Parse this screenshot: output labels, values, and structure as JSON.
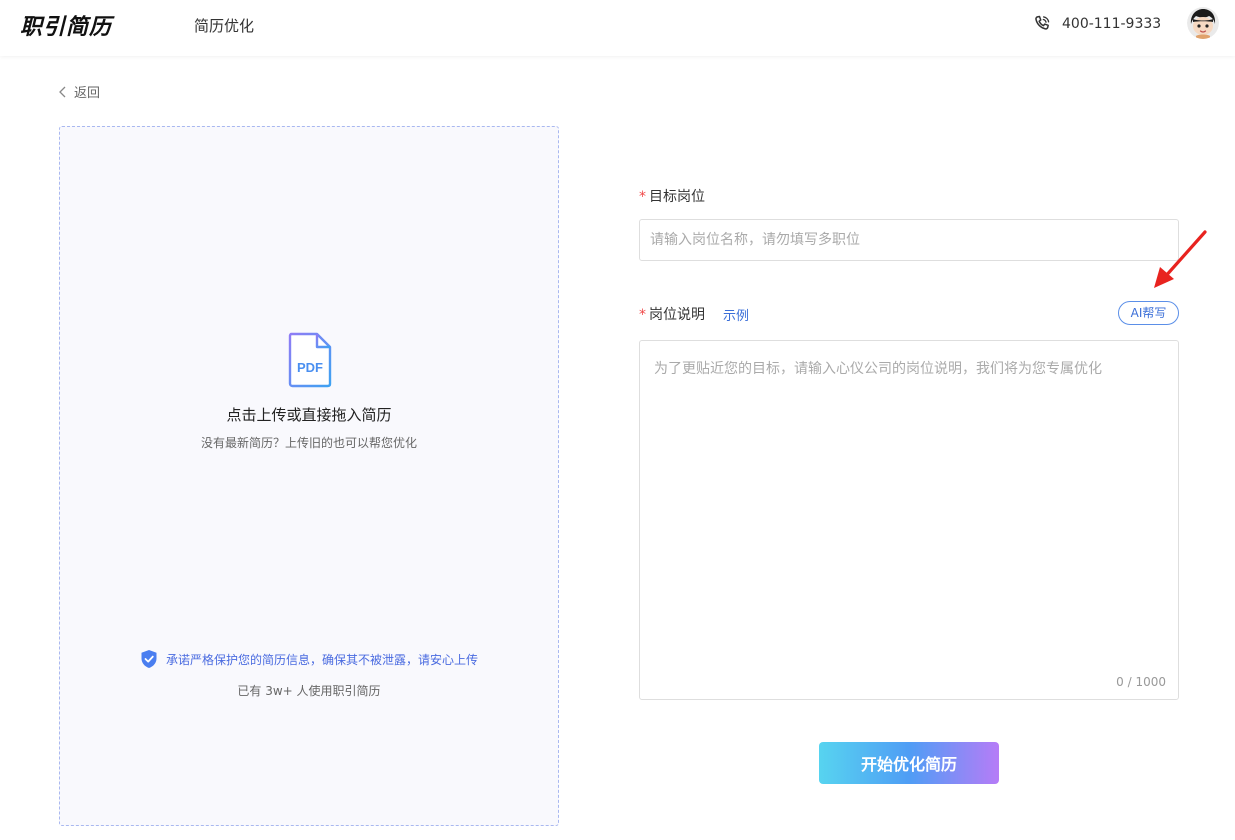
{
  "header": {
    "logo": "职引简历",
    "nav_item": "简历优化",
    "phone": "400-111-9333"
  },
  "back_label": "返回",
  "upload": {
    "pdf_label": "PDF",
    "title": "点击上传或直接拖入简历",
    "subtitle": "没有最新简历？上传旧的也可以帮您优化",
    "promise": "承诺严格保护您的简历信息，确保其不被泄露，请安心上传",
    "users": "已有 3w+ 人使用职引简历"
  },
  "form": {
    "required_mark": "*",
    "job_label": "目标岗位",
    "job_placeholder": "请输入岗位名称，请勿填写多职位",
    "desc_label": "岗位说明",
    "example_link": "示例",
    "ai_button": "AI帮写",
    "desc_placeholder": "为了更贴近您的目标，请输入心仪公司的岗位说明，我们将为您专属优化",
    "counter": "0 / 1000",
    "submit": "开始优化简历"
  },
  "colors": {
    "accent": "#3b6fd8",
    "required": "#f04848",
    "annotation_arrow": "#e8231f"
  }
}
